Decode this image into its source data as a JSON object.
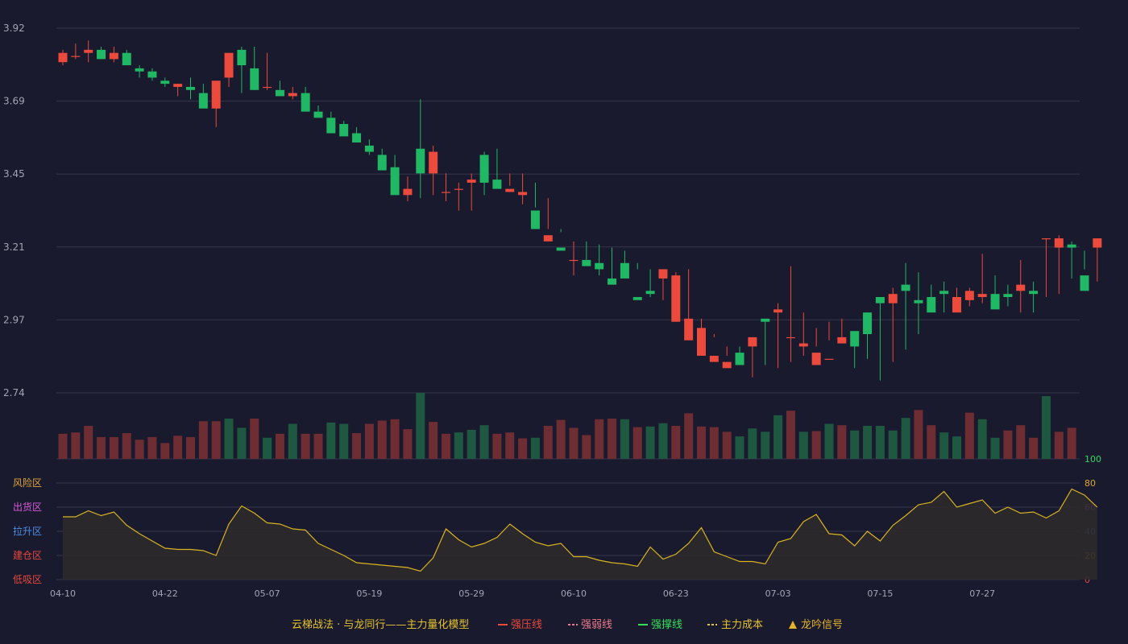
{
  "colors": {
    "background": "#191a2d",
    "grid": "#353649",
    "up": "#eb4a3c",
    "down": "#21b865",
    "vol_up": "#6e2c33",
    "vol_down": "#1e5840",
    "indicator_line": "#d9b421",
    "indicator_fill": "#2d2a2c",
    "axis_text": "#a4a5b3"
  },
  "chart_data": [
    {
      "type": "candlestick",
      "x": [
        "04-10",
        "04-11",
        "04-12",
        "04-15",
        "04-16",
        "04-17",
        "04-18",
        "04-19",
        "04-22",
        "04-23",
        "04-24",
        "04-25",
        "04-26",
        "04-29",
        "04-30",
        "05-06",
        "05-07",
        "05-08",
        "05-09",
        "05-10",
        "05-13",
        "05-14",
        "05-15",
        "05-16",
        "05-17",
        "05-20",
        "05-21",
        "05-22",
        "05-23",
        "05-24",
        "05-27",
        "05-28",
        "05-29",
        "05-30",
        "05-31",
        "06-03",
        "06-04",
        "06-05",
        "06-06",
        "06-07",
        "06-11",
        "06-12",
        "06-13",
        "06-14",
        "06-17",
        "06-18",
        "06-19",
        "06-20",
        "06-21",
        "06-24",
        "06-25",
        "06-26",
        "06-27",
        "06-28",
        "07-01",
        "07-02",
        "07-03",
        "07-04",
        "07-05",
        "07-08",
        "07-09",
        "07-10",
        "07-11",
        "07-12",
        "07-15",
        "07-16",
        "07-17",
        "07-18",
        "07-19",
        "07-22",
        "07-23",
        "07-24",
        "07-25",
        "07-26",
        "07-29",
        "07-30",
        "07-31",
        "08-01",
        "08-02",
        "08-05",
        "08-06",
        "08-07"
      ],
      "open": [
        3.81,
        3.83,
        3.84,
        3.85,
        3.82,
        3.84,
        3.79,
        3.78,
        3.75,
        3.73,
        3.73,
        3.71,
        3.66,
        3.76,
        3.85,
        3.79,
        3.73,
        3.72,
        3.7,
        3.71,
        3.65,
        3.63,
        3.61,
        3.58,
        3.54,
        3.51,
        3.47,
        3.38,
        3.53,
        3.45,
        3.39,
        3.4,
        3.42,
        3.51,
        3.43,
        3.39,
        3.38,
        3.33,
        3.23,
        3.21,
        3.17,
        3.17,
        3.16,
        3.11,
        3.16,
        3.05,
        3.07,
        3.11,
        2.97,
        2.91,
        2.86,
        2.84,
        2.82,
        2.87,
        2.89,
        2.98,
        3.0,
        2.92,
        2.89,
        2.83,
        2.85,
        2.9,
        2.94,
        3.0,
        3.05,
        3.03,
        3.09,
        3.04,
        3.05,
        3.07,
        3.0,
        3.04,
        3.05,
        3.06,
        3.06,
        3.07,
        3.07,
        3.24,
        3.21,
        3.22,
        3.12,
        3.21
      ],
      "high": [
        3.85,
        3.87,
        3.88,
        3.86,
        3.86,
        3.85,
        3.8,
        3.79,
        3.76,
        3.74,
        3.76,
        3.74,
        3.71,
        3.78,
        3.86,
        3.86,
        3.84,
        3.75,
        3.73,
        3.73,
        3.67,
        3.65,
        3.62,
        3.6,
        3.56,
        3.53,
        3.51,
        3.44,
        3.69,
        3.54,
        3.45,
        3.42,
        3.45,
        3.52,
        3.53,
        3.45,
        3.45,
        3.42,
        3.37,
        3.26,
        3.23,
        3.23,
        3.22,
        3.21,
        3.2,
        3.16,
        3.14,
        3.13,
        3.13,
        3.14,
        2.98,
        2.93,
        2.89,
        2.89,
        2.92,
        2.97,
        3.03,
        3.15,
        3.0,
        2.95,
        2.97,
        2.98,
        2.93,
        3.0,
        3.03,
        3.08,
        3.16,
        3.13,
        3.09,
        3.1,
        3.08,
        3.08,
        3.19,
        3.12,
        3.09,
        3.17,
        3.1,
        3.24,
        3.25,
        3.23,
        3.14,
        3.24
      ],
      "low": [
        3.8,
        3.82,
        3.81,
        3.82,
        3.81,
        3.82,
        3.76,
        3.75,
        3.73,
        3.7,
        3.69,
        3.71,
        3.6,
        3.73,
        3.71,
        3.72,
        3.72,
        3.72,
        3.69,
        3.7,
        3.64,
        3.61,
        3.57,
        3.55,
        3.51,
        3.5,
        3.43,
        3.36,
        3.37,
        3.38,
        3.36,
        3.33,
        3.33,
        3.38,
        3.43,
        3.41,
        3.35,
        3.34,
        3.27,
        3.27,
        3.12,
        3.16,
        3.12,
        3.11,
        3.12,
        3.14,
        3.05,
        3.04,
        3.01,
        2.95,
        2.94,
        2.92,
        2.86,
        2.84,
        2.79,
        2.83,
        2.82,
        2.84,
        2.86,
        2.89,
        2.91,
        2.92,
        2.82,
        2.85,
        2.78,
        2.84,
        2.88,
        2.93,
        3.0,
        3.0,
        3.04,
        3.02,
        3.03,
        3.02,
        3.02,
        3.0,
        3.0,
        3.05,
        3.06,
        3.11,
        3.2,
        3.1
      ],
      "close": [
        3.84,
        3.83,
        3.85,
        3.82,
        3.84,
        3.8,
        3.78,
        3.76,
        3.74,
        3.74,
        3.72,
        3.66,
        3.75,
        3.84,
        3.8,
        3.72,
        3.73,
        3.7,
        3.71,
        3.65,
        3.63,
        3.58,
        3.57,
        3.55,
        3.52,
        3.46,
        3.38,
        3.4,
        3.45,
        3.52,
        3.39,
        3.4,
        3.43,
        3.42,
        3.4,
        3.4,
        3.39,
        3.27,
        3.25,
        3.2,
        3.17,
        3.15,
        3.14,
        3.09,
        3.11,
        3.04,
        3.06,
        3.14,
        3.12,
        2.98,
        2.95,
        2.86,
        2.84,
        2.83,
        2.92,
        2.97,
        3.01,
        2.92,
        2.9,
        2.87,
        2.85,
        2.92,
        2.89,
        2.93,
        3.03,
        3.06,
        3.07,
        3.03,
        3.0,
        3.06,
        3.05,
        3.07,
        3.06,
        3.01,
        3.05,
        3.09,
        3.06,
        3.24,
        3.24,
        3.21,
        3.07,
        3.24
      ],
      "ylim": [
        2.74,
        3.92
      ],
      "y_ticks": [
        "3.92",
        "3.69",
        "3.45",
        "3.21",
        "2.97",
        "2.74"
      ]
    },
    {
      "type": "bar",
      "name": "volume",
      "values": [
        38,
        40,
        50,
        33,
        33,
        39,
        29,
        33,
        24,
        35,
        33,
        57,
        57,
        61,
        47,
        61,
        32,
        38,
        53,
        38,
        38,
        55,
        53,
        39,
        53,
        58,
        60,
        45,
        100,
        56,
        38,
        40,
        44,
        51,
        38,
        40,
        31,
        32,
        50,
        59,
        47,
        36,
        60,
        61,
        60,
        48,
        49,
        54,
        50,
        69,
        49,
        48,
        41,
        34,
        46,
        41,
        66,
        73,
        41,
        42,
        53,
        51,
        43,
        50,
        50,
        43,
        62,
        74,
        51,
        40,
        34,
        70,
        60,
        32,
        43,
        51,
        32,
        95,
        41,
        47
      ],
      "up": [
        true,
        true,
        true,
        true,
        true,
        true,
        true,
        true,
        true,
        true,
        true,
        true,
        true,
        false,
        false,
        true,
        false,
        true,
        false,
        true,
        true,
        false,
        false,
        true,
        true,
        true,
        true,
        true,
        false,
        true,
        true,
        false,
        false,
        false,
        true,
        true,
        true,
        false,
        true,
        true,
        true,
        true,
        true,
        true,
        false,
        true,
        false,
        false,
        true,
        true,
        true,
        true,
        true,
        false,
        false,
        false,
        false,
        true,
        false,
        true,
        false,
        true,
        false,
        false,
        false,
        false,
        false,
        true,
        true,
        false,
        false,
        true,
        false,
        false,
        true,
        true,
        true,
        false,
        true,
        true
      ]
    },
    {
      "type": "area",
      "name": "",
      "values": [
        52,
        52,
        57,
        53,
        56,
        45,
        38,
        32,
        26,
        25,
        25,
        24,
        20,
        46,
        61,
        55,
        47,
        46,
        42,
        41,
        30,
        25,
        20,
        14,
        13,
        12,
        11,
        10,
        7,
        18,
        42,
        33,
        27,
        30,
        35,
        46,
        38,
        31,
        28,
        30,
        19,
        19,
        16,
        14,
        13,
        11,
        27,
        17,
        21,
        30,
        43,
        23,
        19,
        15,
        15,
        13,
        31,
        34,
        48,
        54,
        38,
        37,
        28,
        40,
        32,
        45,
        53,
        62,
        64,
        73,
        60,
        63,
        66,
        55,
        60,
        55,
        56,
        51,
        57,
        75,
        70,
        60
      ],
      "ylim": [
        0,
        100
      ],
      "y_ticks": [
        "100",
        "80",
        "60",
        "40",
        "20",
        "0"
      ],
      "y_tick_colors": [
        "#36d665",
        "#e0a63a",
        "#d959dc",
        "#4e8de8",
        "#e0a63a",
        "#e8473f"
      ],
      "zone_labels": [
        "风险区",
        "出货区",
        "拉升区",
        "建仓区",
        "低吸区"
      ],
      "zone_colors": [
        "#e0a63a",
        "#d959dc",
        "#4e8de8",
        "#e8473f",
        "#e8473f"
      ]
    }
  ],
  "x_axis": {
    "tick_labels": [
      "04-10",
      "04-22",
      "05-07",
      "05-19",
      "05-29",
      "06-10",
      "06-23",
      "07-03",
      "07-15",
      "07-27"
    ],
    "tick_indices": [
      0,
      8,
      16,
      24,
      32,
      40,
      48,
      56,
      64,
      72
    ]
  },
  "legend": {
    "title": "云梯战法 · 与龙同行——主力量化模型",
    "items": [
      {
        "label": "强压线",
        "color": "#eb4a3c",
        "style": "solid"
      },
      {
        "label": "强弱线",
        "color": "#f07a8d",
        "style": "dashed"
      },
      {
        "label": "强撑线",
        "color": "#36e05b",
        "style": "solid"
      },
      {
        "label": "主力成本",
        "color": "#e6c22f",
        "style": "dashed"
      },
      {
        "label": "龙吟信号",
        "color": "#e6b42a",
        "style": "triangle"
      }
    ]
  }
}
